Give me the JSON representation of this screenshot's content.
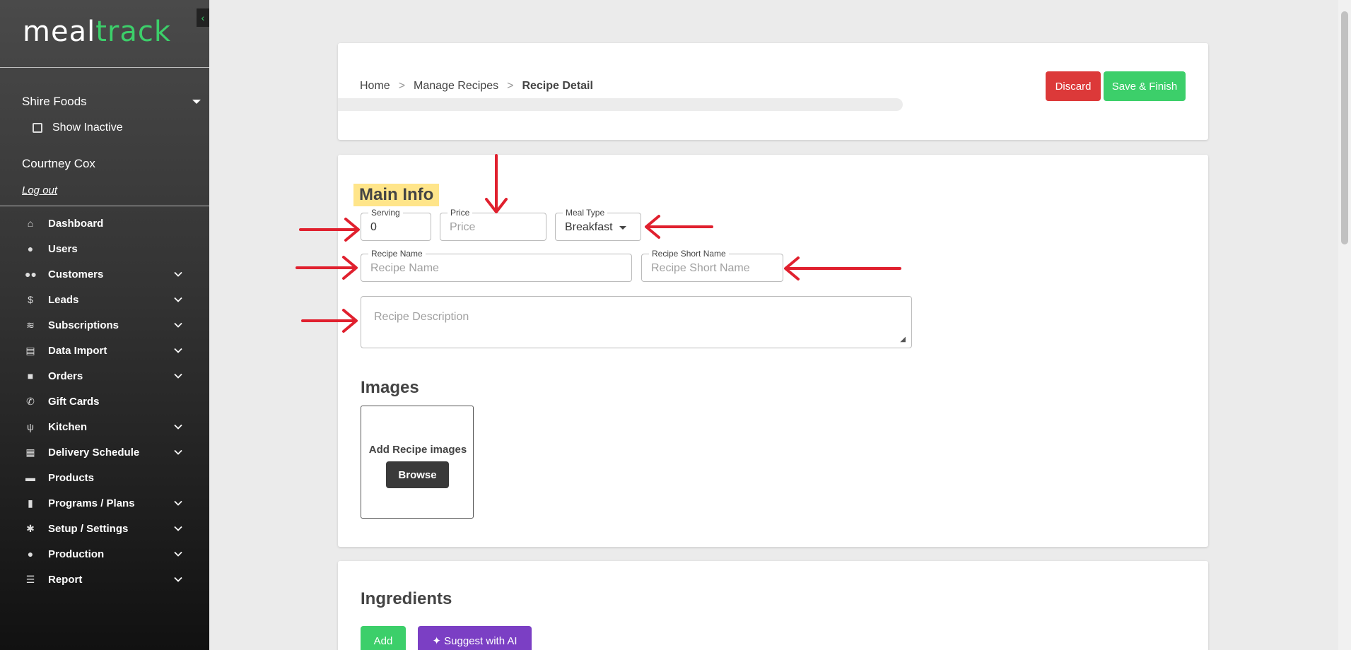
{
  "brand": {
    "logo_part1": "meal",
    "logo_part2": "track",
    "accent": "#3ccf6a"
  },
  "sidebar": {
    "organization": "Shire Foods",
    "show_inactive_label": "Show Inactive",
    "user_name": "Courtney Cox",
    "logout_label": "Log out",
    "items": [
      {
        "label": "Dashboard",
        "icon": "home-icon",
        "glyph": "⌂",
        "has_submenu": false
      },
      {
        "label": "Users",
        "icon": "user-icon",
        "glyph": "●",
        "has_submenu": false
      },
      {
        "label": "Customers",
        "icon": "users-icon",
        "glyph": "●●",
        "has_submenu": true
      },
      {
        "label": "Leads",
        "icon": "dollar-icon",
        "glyph": "$",
        "has_submenu": true
      },
      {
        "label": "Subscriptions",
        "icon": "layers-icon",
        "glyph": "≋",
        "has_submenu": true
      },
      {
        "label": "Data Import",
        "icon": "file-icon",
        "glyph": "▤",
        "has_submenu": true
      },
      {
        "label": "Orders",
        "icon": "bag-icon",
        "glyph": "■",
        "has_submenu": true
      },
      {
        "label": "Gift Cards",
        "icon": "phone-icon",
        "glyph": "✆",
        "has_submenu": false
      },
      {
        "label": "Kitchen",
        "icon": "utensils-icon",
        "glyph": "ψ",
        "has_submenu": true
      },
      {
        "label": "Delivery Schedule",
        "icon": "calendar-icon",
        "glyph": "▦",
        "has_submenu": true
      },
      {
        "label": "Products",
        "icon": "calendar-icon",
        "glyph": "▬",
        "has_submenu": false
      },
      {
        "label": "Programs / Plans",
        "icon": "clipboard-icon",
        "glyph": "▮",
        "has_submenu": true
      },
      {
        "label": "Setup / Settings",
        "icon": "gear-icon",
        "glyph": "✱",
        "has_submenu": true
      },
      {
        "label": "Production",
        "icon": "user-tie-icon",
        "glyph": "●",
        "has_submenu": true
      },
      {
        "label": "Report",
        "icon": "list-check-icon",
        "glyph": "☰",
        "has_submenu": true
      }
    ]
  },
  "header": {
    "breadcrumb": [
      "Home",
      "Manage Recipes",
      "Recipe Detail"
    ],
    "breadcrumb_separator": ">",
    "discard_label": "Discard",
    "save_label": "Save & Finish"
  },
  "main_info": {
    "title": "Main Info",
    "serving": {
      "label": "Serving",
      "value": "0"
    },
    "price": {
      "label": "Price",
      "placeholder": "Price"
    },
    "meal_type": {
      "label": "Meal Type",
      "value": "Breakfast"
    },
    "recipe_name": {
      "label": "Recipe Name",
      "placeholder": "Recipe Name"
    },
    "recipe_short_name": {
      "label": "Recipe Short Name",
      "placeholder": "Recipe Short Name"
    },
    "recipe_description": {
      "placeholder": "Recipe Description"
    }
  },
  "images": {
    "title": "Images",
    "prompt": "Add Recipe images",
    "browse_label": "Browse"
  },
  "ingredients": {
    "title": "Ingredients",
    "add_label": "Add",
    "ai_label": "Suggest with AI",
    "ai_icon": "sparkle-icon"
  },
  "colors": {
    "discard": "#dc3939",
    "save": "#3ccf6a",
    "ai": "#7b3fc4",
    "annotation": "#e0202e",
    "highlight": "#ffe58a"
  }
}
